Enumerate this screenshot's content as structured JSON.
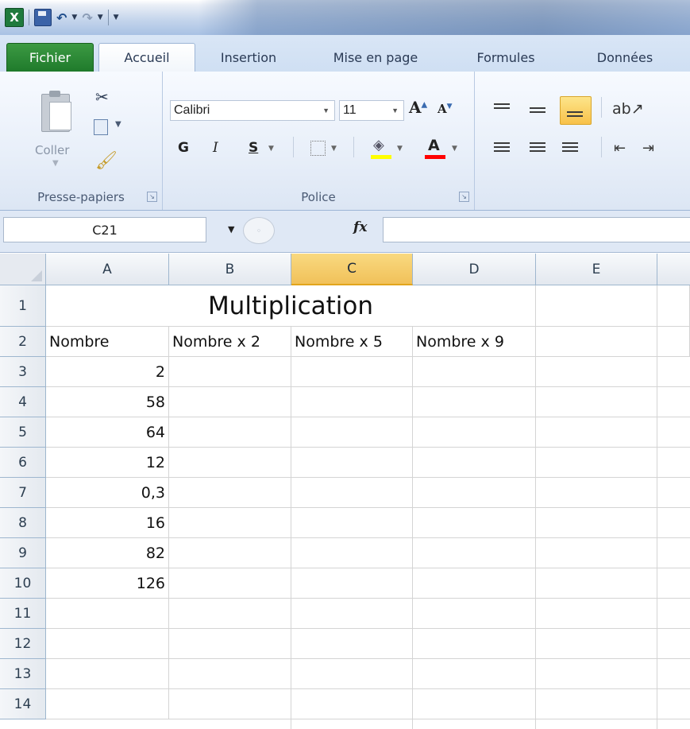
{
  "titlebar": {
    "app_icon": "X",
    "save_icon": "save-icon",
    "undo_icon": "undo-icon",
    "redo_icon": "redo-icon",
    "customize_icon": "customize-qat-icon"
  },
  "tabs": [
    {
      "label": "Fichier",
      "active": false
    },
    {
      "label": "Accueil",
      "active": true
    },
    {
      "label": "Insertion",
      "active": false
    },
    {
      "label": "Mise en page",
      "active": false
    },
    {
      "label": "Formules",
      "active": false
    },
    {
      "label": "Données",
      "active": false
    }
  ],
  "ribbon": {
    "clipboard": {
      "paste_label": "Coller",
      "group_label": "Presse-papiers"
    },
    "font": {
      "name": "Calibri",
      "size": "11",
      "bold": "G",
      "italic": "I",
      "underline": "S",
      "grow": "A",
      "shrink": "A",
      "font_color": "A",
      "group_label": "Police",
      "fill_color": "#ffff00",
      "text_color": "#ff0000"
    }
  },
  "formula_bar": {
    "name_box": "C21",
    "fx": "fx",
    "formula": ""
  },
  "sheet": {
    "columns": [
      "A",
      "B",
      "C",
      "D",
      "E"
    ],
    "selected_column": "C",
    "rows": [
      "1",
      "2",
      "3",
      "4",
      "5",
      "6",
      "7",
      "8",
      "9",
      "10",
      "11",
      "12",
      "13",
      "14"
    ],
    "title": "Multiplication",
    "headers": [
      "Nombre",
      "Nombre x 2",
      "Nombre x 5",
      "Nombre x 9"
    ],
    "values": [
      "2",
      "58",
      "64",
      "12",
      "0,3",
      "16",
      "82",
      "126"
    ]
  }
}
